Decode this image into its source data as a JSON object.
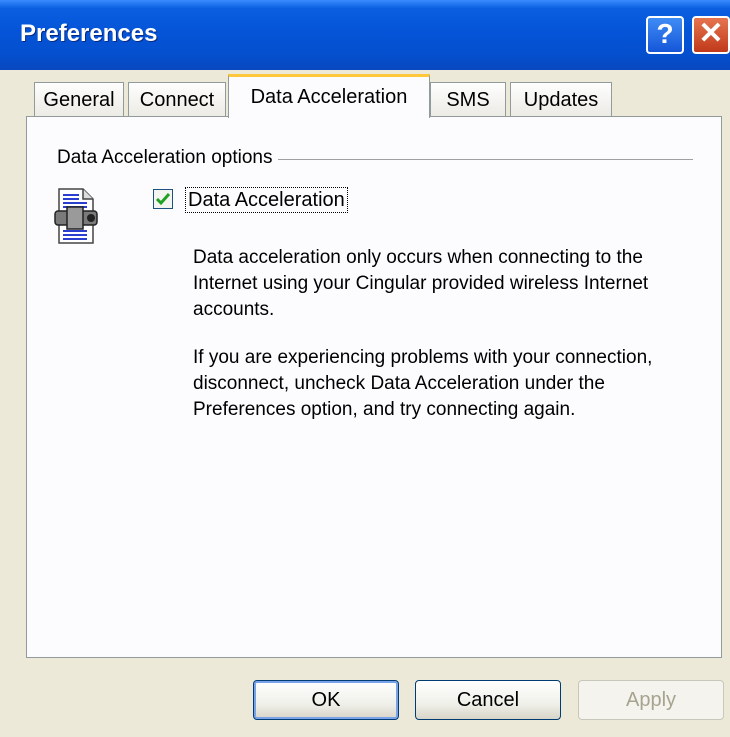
{
  "window": {
    "title": "Preferences",
    "help_glyph": "?",
    "close_glyph": "✕"
  },
  "tabs": [
    {
      "label": "General",
      "active": false
    },
    {
      "label": "Connect",
      "active": false
    },
    {
      "label": "Data Acceleration",
      "active": true
    },
    {
      "label": "SMS",
      "active": false
    },
    {
      "label": "Updates",
      "active": false
    }
  ],
  "panel": {
    "group_label": "Data Acceleration options",
    "icon": "data-acceleration-icon",
    "checkbox": {
      "label": "Data Acceleration",
      "checked": true
    },
    "paragraph1": "Data acceleration only occurs when connecting to the Internet using your Cingular provided wireless Internet accounts.",
    "paragraph2": "If you are experiencing problems with your connection, disconnect, uncheck Data Acceleration under the Preferences option, and try connecting again."
  },
  "buttons": {
    "ok": "OK",
    "cancel": "Cancel",
    "apply": "Apply"
  },
  "colors": {
    "titlebar": "#0554d8",
    "active_tab_accent": "#ffc83c",
    "check": "#21a121"
  }
}
